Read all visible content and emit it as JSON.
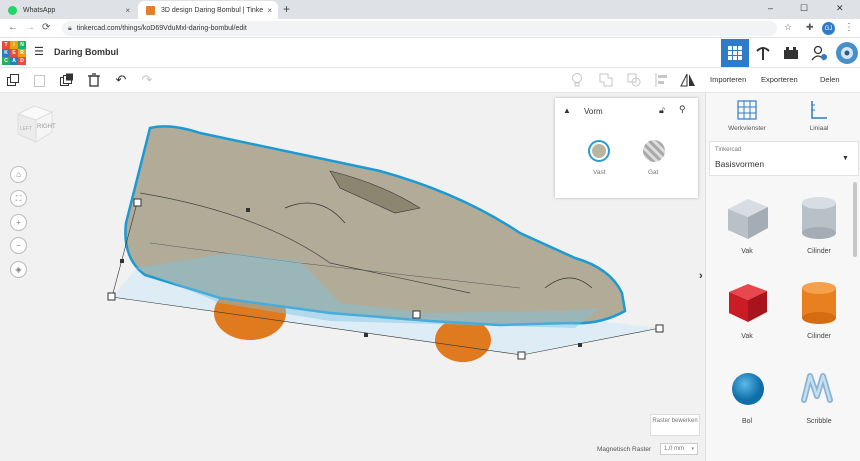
{
  "browser": {
    "tabs": [
      {
        "title": "WhatsApp",
        "close": "×"
      },
      {
        "title": "3D design Daring Bombul | Tinke",
        "close": "×"
      }
    ],
    "new_tab": "+",
    "window_controls": [
      "–",
      "☐",
      "✕"
    ],
    "url": "tinkercad.com/things/koD69VduMxl-daring-bombul/edit",
    "profile_initials": "GJ"
  },
  "app": {
    "logo_letters": [
      "T",
      "I",
      "N",
      "K",
      "E",
      "R",
      "C",
      "A",
      "D"
    ],
    "document_name": "Daring Bombul"
  },
  "side_tabs": {
    "import": "Importeren",
    "export": "Exporteren",
    "share": "Delen"
  },
  "viewcube": {
    "front": "LEFT",
    "right": "RIGHT"
  },
  "shape_panel": {
    "title": "Vorm",
    "solid_label": "Vast",
    "hole_label": "Gat",
    "solid_color": "#b9b59e"
  },
  "right_panel": {
    "workplane_label": "Werkvlenster",
    "ruler_label": "Liniaal",
    "library_category": "Tinkercad",
    "library_name": "Basisvormen",
    "shapes": [
      {
        "name": "Vak",
        "color": "#b8c0c8",
        "icon": "box-hole-icon"
      },
      {
        "name": "Cilinder",
        "color": "#b8c0c8",
        "icon": "cylinder-hole-icon"
      },
      {
        "name": "Vak",
        "color": "#d42027",
        "icon": "box-icon"
      },
      {
        "name": "Cilinder",
        "color": "#ea7a1e",
        "icon": "cylinder-icon"
      },
      {
        "name": "Bol",
        "color": "#1a86c6",
        "icon": "sphere-icon"
      },
      {
        "name": "Scribble",
        "color": "#9cc0dc",
        "icon": "scribble-icon"
      }
    ]
  },
  "grid": {
    "edit_label": "Raster bewerken",
    "snap_label": "Magnetisch Raster",
    "snap_value": "1,0 mm"
  },
  "colors": {
    "selection_blue": "#22a6d9",
    "tinkercad_blue": "#2e7cc9"
  }
}
